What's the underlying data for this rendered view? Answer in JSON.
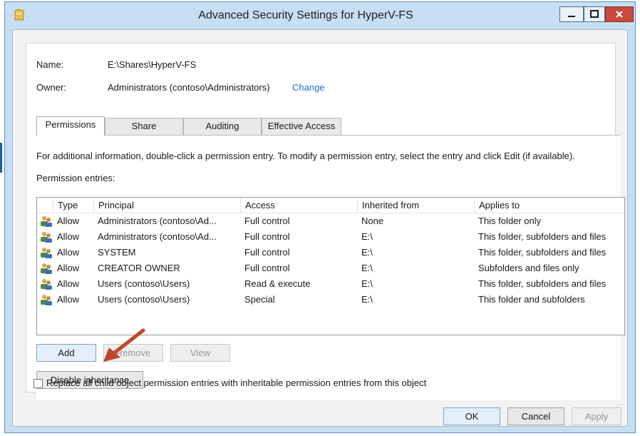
{
  "window": {
    "title": "Advanced Security Settings for HyperV-FS",
    "minimize_icon": "minimize-icon",
    "maximize_icon": "maximize-icon",
    "close_icon": "close-icon"
  },
  "header": {
    "name_label": "Name:",
    "name_value": "E:\\Shares\\HyperV-FS",
    "owner_label": "Owner:",
    "owner_value": "Administrators (contoso\\Administrators)",
    "change_link": "Change"
  },
  "tabs": [
    {
      "label": "Permissions",
      "active": true
    },
    {
      "label": "Share",
      "active": false
    },
    {
      "label": "Auditing",
      "active": false
    },
    {
      "label": "Effective Access",
      "active": false
    }
  ],
  "permissions": {
    "info_text": "For additional information, double-click a permission entry. To modify a permission entry, select the entry and click Edit (if available).",
    "entries_label": "Permission entries:",
    "columns": [
      "Type",
      "Principal",
      "Access",
      "Inherited from",
      "Applies to"
    ],
    "rows": [
      {
        "type": "Allow",
        "principal": "Administrators (contoso\\Ad...",
        "access": "Full control",
        "inherited": "None",
        "applies": "This folder only"
      },
      {
        "type": "Allow",
        "principal": "Administrators (contoso\\Ad...",
        "access": "Full control",
        "inherited": "E:\\",
        "applies": "This folder, subfolders and files"
      },
      {
        "type": "Allow",
        "principal": "SYSTEM",
        "access": "Full control",
        "inherited": "E:\\",
        "applies": "This folder, subfolders and files"
      },
      {
        "type": "Allow",
        "principal": "CREATOR OWNER",
        "access": "Full control",
        "inherited": "E:\\",
        "applies": "Subfolders and files only"
      },
      {
        "type": "Allow",
        "principal": "Users (contoso\\Users)",
        "access": "Read & execute",
        "inherited": "E:\\",
        "applies": "This folder, subfolders and files"
      },
      {
        "type": "Allow",
        "principal": "Users (contoso\\Users)",
        "access": "Special",
        "inherited": "E:\\",
        "applies": "This folder and subfolders"
      }
    ],
    "row_icon": "users-icon",
    "add_button": "Add",
    "remove_button": "Remove",
    "view_button": "View",
    "disable_inheritance_button": "Disable inheritance",
    "replace_checkbox_label": "Replace all child object permission entries with inheritable permission entries from this object",
    "replace_checked": false
  },
  "footer": {
    "ok_button": "OK",
    "cancel_button": "Cancel",
    "apply_button": "Apply"
  },
  "colors": {
    "window_frame": "#c7dff4",
    "close_button": "#c74a3b",
    "link": "#1f6fc4",
    "annotation_arrow": "#c0462a"
  }
}
